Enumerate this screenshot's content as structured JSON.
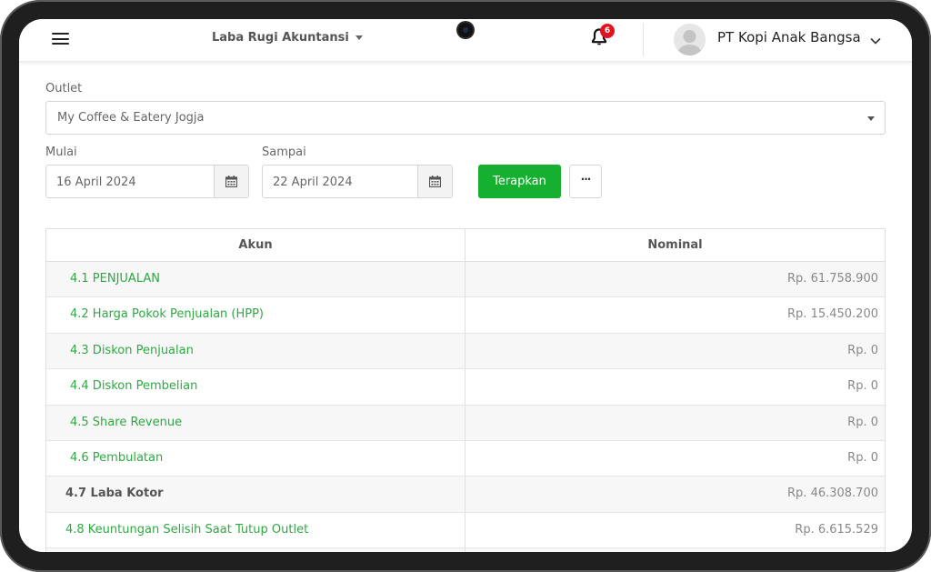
{
  "header": {
    "page_menu": "Laba Rugi Akuntansi",
    "notification_count": "6",
    "company": "PT Kopi Anak Bangsa"
  },
  "filters": {
    "outlet_label": "Outlet",
    "outlet_value": "My Coffee & Eatery Jogja",
    "start_label": "Mulai",
    "start_value": "16 April 2024",
    "end_label": "Sampai",
    "end_value": "22 April 2024",
    "apply_label": "Terapkan",
    "more_label": "···"
  },
  "table": {
    "headers": [
      "Akun",
      "Nominal"
    ],
    "rows": [
      {
        "account": "4.1 PENJUALAN",
        "nominal": "Rp. 61.758.900"
      },
      {
        "account": "4.2 Harga Pokok Penjualan (HPP)",
        "nominal": "Rp. 15.450.200"
      },
      {
        "account": "4.3 Diskon Penjualan",
        "nominal": "Rp. 0"
      },
      {
        "account": "4.4 Diskon Pembelian",
        "nominal": "Rp. 0"
      },
      {
        "account": "4.5 Share Revenue",
        "nominal": "Rp. 0"
      },
      {
        "account": "4.6 Pembulatan",
        "nominal": "Rp. 0"
      },
      {
        "account": "4.7 Laba Kotor",
        "nominal": "Rp. 46.308.700"
      },
      {
        "account": "4.8 Keuntungan Selisih Saat Tutup Outlet",
        "nominal": "Rp. 6.615.529"
      }
    ]
  },
  "colors": {
    "accent_green": "#15b02f",
    "link_green": "#2fa844",
    "badge_red": "#e0141e"
  }
}
